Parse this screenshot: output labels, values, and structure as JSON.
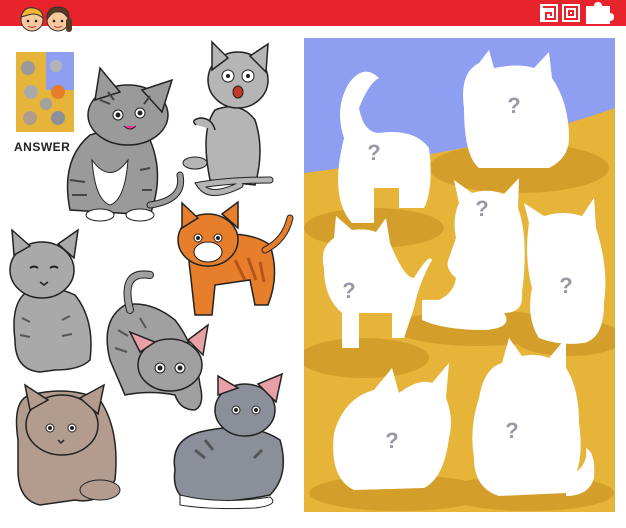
{
  "header": {
    "brand_color": "#e8232c"
  },
  "answer_panel": {
    "label": "ANSWER"
  },
  "puzzle": {
    "sky_color": "#8e9ef0",
    "ground_color": "#e7b43a",
    "silhouette_color": "#ffffff",
    "question_mark": "?"
  },
  "cats": [
    {
      "name": "tabby-sitting-cat",
      "color": "#9a9a9a"
    },
    {
      "name": "grey-surprised-cat",
      "color": "#b5b5b5"
    },
    {
      "name": "orange-striped-cat",
      "color": "#e67e2b"
    },
    {
      "name": "fluffy-grey-cat",
      "color": "#a9a9a9"
    },
    {
      "name": "stretching-grey-cat",
      "color": "#a0a0a0"
    },
    {
      "name": "brown-fluffy-cat",
      "color": "#b39c8e"
    },
    {
      "name": "grey-lying-cat",
      "color": "#8a8f99"
    }
  ]
}
